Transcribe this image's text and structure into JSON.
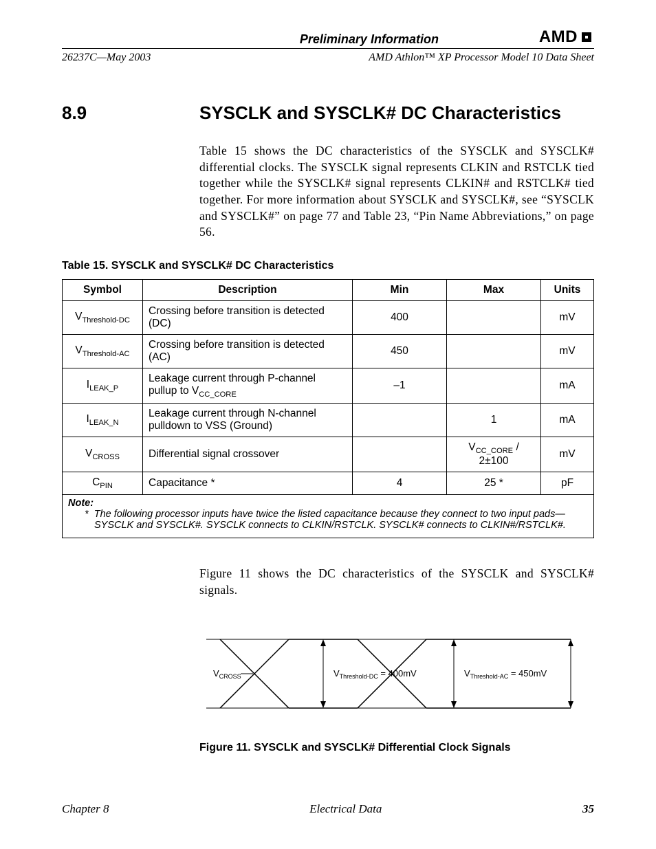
{
  "header": {
    "preliminary": "Preliminary Information",
    "logo_text": "AMD",
    "docnum": "26237C—May 2003",
    "doc_title": "AMD Athlon™ XP Processor Model 10 Data Sheet"
  },
  "section": {
    "number": "8.9",
    "title": "SYSCLK and SYSCLK# DC Characteristics",
    "paragraph": "Table 15 shows the DC characteristics of the SYSCLK and SYSCLK# differential clocks. The SYSCLK signal represents CLKIN and RSTCLK tied together while the SYSCLK# signal represents CLKIN# and RSTCLK# tied together. For more information about SYSCLK and SYSCLK#, see “SYSCLK and SYSCLK#” on page 77 and Table 23, “Pin Name Abbreviations,” on page 56."
  },
  "table": {
    "caption": "Table 15.  SYSCLK and SYSCLK# DC Characteristics",
    "headers": {
      "symbol": "Symbol",
      "description": "Description",
      "min": "Min",
      "max": "Max",
      "units": "Units"
    },
    "rows": [
      {
        "sym_base": "V",
        "sym_sub": "Threshold-DC",
        "desc": "Crossing before transition is detected (DC)",
        "min": "400",
        "max": "",
        "units": "mV"
      },
      {
        "sym_base": "V",
        "sym_sub": "Threshold-AC",
        "desc": "Crossing before transition is detected (AC)",
        "min": "450",
        "max": "",
        "units": "mV"
      },
      {
        "sym_base": "I",
        "sym_sub": "LEAK_P",
        "desc_pre": "Leakage current through P-channel pullup to V",
        "desc_sub": "CC_CORE",
        "min": "–1",
        "max": "",
        "units": "mA"
      },
      {
        "sym_base": "I",
        "sym_sub": "LEAK_N",
        "desc": "Leakage current through N-channel pulldown to VSS (Ground)",
        "min": "",
        "max": "1",
        "units": "mA"
      },
      {
        "sym_base": "V",
        "sym_sub": "CROSS",
        "desc": "Differential signal crossover",
        "min": "",
        "max_pre": "V",
        "max_sub": "CC_CORE",
        "max_post": " / 2±100",
        "units": "mV"
      },
      {
        "sym_base": "C",
        "sym_sub": "PIN",
        "desc": "Capacitance *",
        "min": "4",
        "max": "25 *",
        "units": "pF"
      }
    ],
    "note_label": "Note:",
    "note_marker": "*",
    "note_text": "The following processor inputs have twice the listed capacitance because they connect to two input pads—SYSCLK and SYSCLK#. SYSCLK connects to CLKIN/RSTCLK. SYSCLK# connects to CLKIN#/RSTCLK#."
  },
  "figure": {
    "intro": "Figure 11 shows the DC characteristics of the SYSCLK and SYSCLK# signals.",
    "label_vcross": "V",
    "label_vcross_sub": "CROSS",
    "label_dc_pre": "V",
    "label_dc_sub": "Threshold-DC",
    "label_dc_post": " = 400mV",
    "label_ac_pre": "V",
    "label_ac_sub": "Threshold-AC",
    "label_ac_post": " = 450mV",
    "caption": "Figure 11.  SYSCLK and SYSCLK# Differential Clock Signals"
  },
  "footer": {
    "chapter": "Chapter 8",
    "section": "Electrical Data",
    "page": "35"
  }
}
